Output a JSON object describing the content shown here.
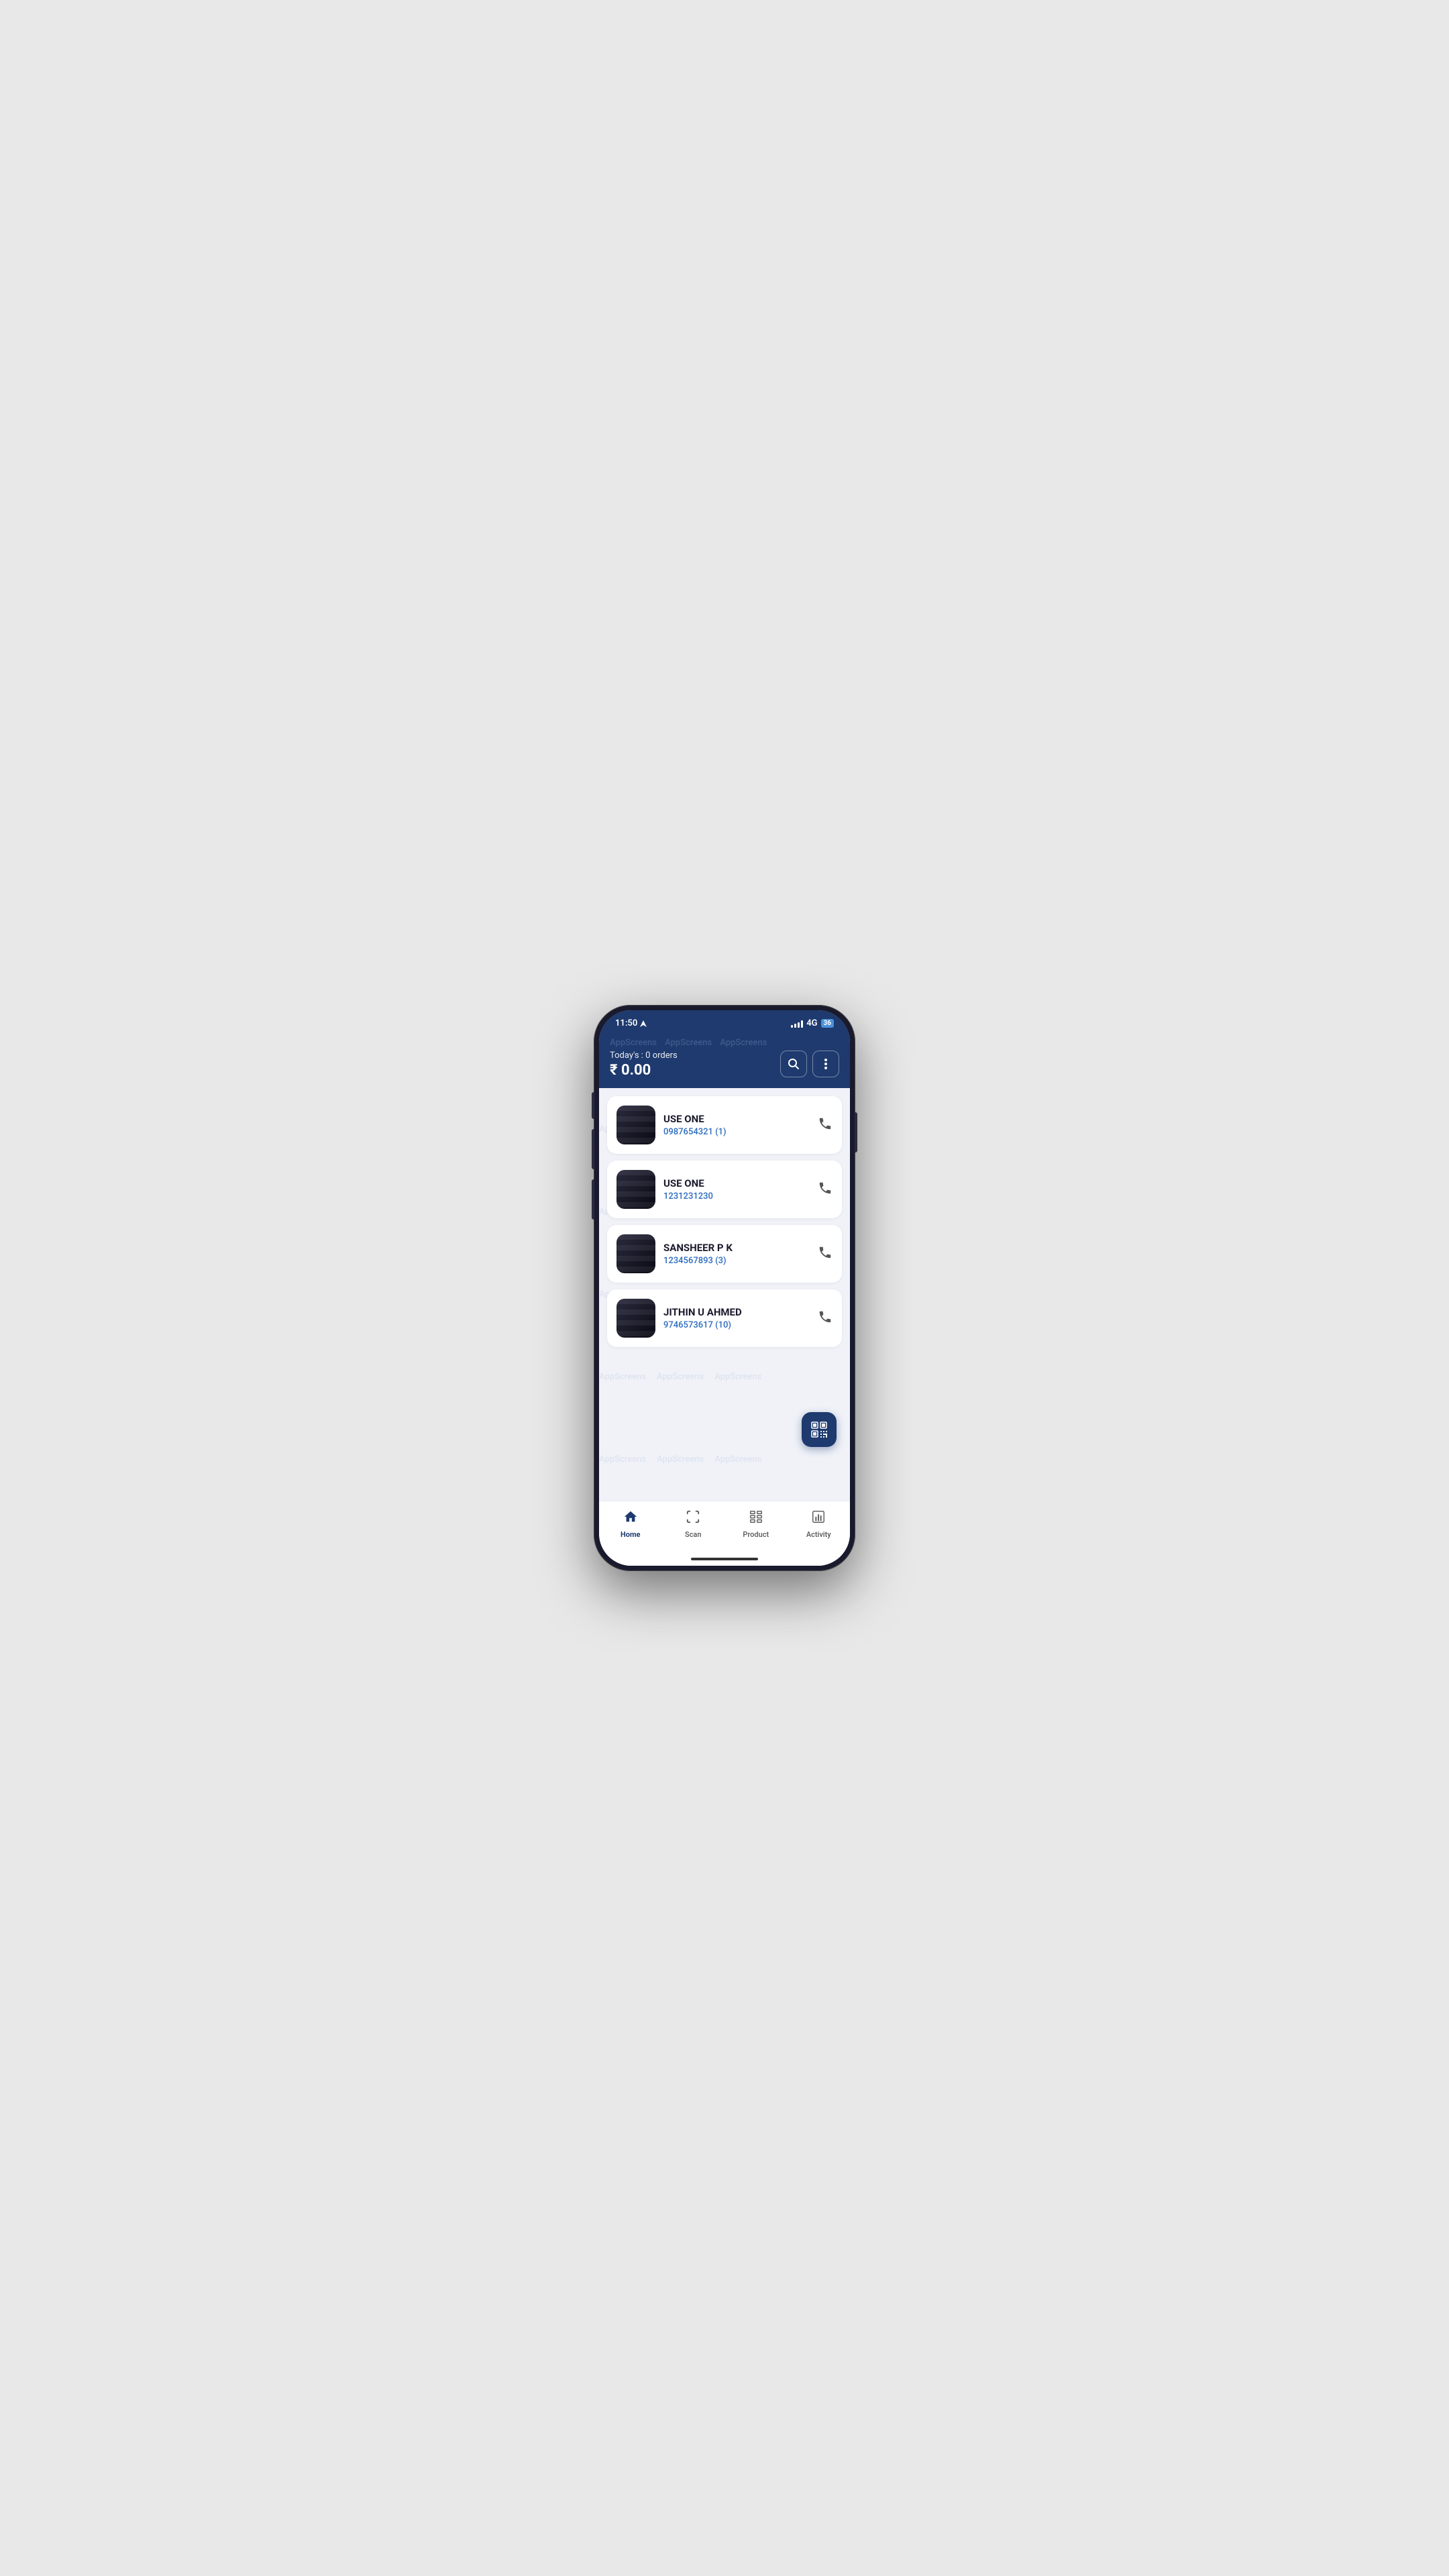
{
  "phone": {
    "status_bar": {
      "time": "11:50",
      "network": "4G",
      "battery": "36"
    },
    "header": {
      "watermarks": [
        "AppScreens",
        "AppScreens",
        "AppScreens"
      ],
      "today_label": "Today's : 0 orders",
      "amount": "₹ 0.00",
      "search_btn": "search",
      "more_btn": "more"
    },
    "customers": [
      {
        "name": "USE ONE",
        "phone": "0987654321 (1)"
      },
      {
        "name": "USE ONE",
        "phone": "1231231230"
      },
      {
        "name": "SANSHEER P K",
        "phone": "1234567893 (3)"
      },
      {
        "name": "JITHIN U AHMED",
        "phone": "9746573617 (10)"
      }
    ],
    "bottom_nav": [
      {
        "id": "home",
        "label": "Home",
        "active": true
      },
      {
        "id": "scan",
        "label": "Scan",
        "active": false
      },
      {
        "id": "product",
        "label": "Product",
        "active": false
      },
      {
        "id": "activity",
        "label": "Activity",
        "active": false
      }
    ],
    "watermark_bg": [
      "AppScreens",
      "AppScreens",
      "AppScreens",
      "AppScreens"
    ]
  }
}
